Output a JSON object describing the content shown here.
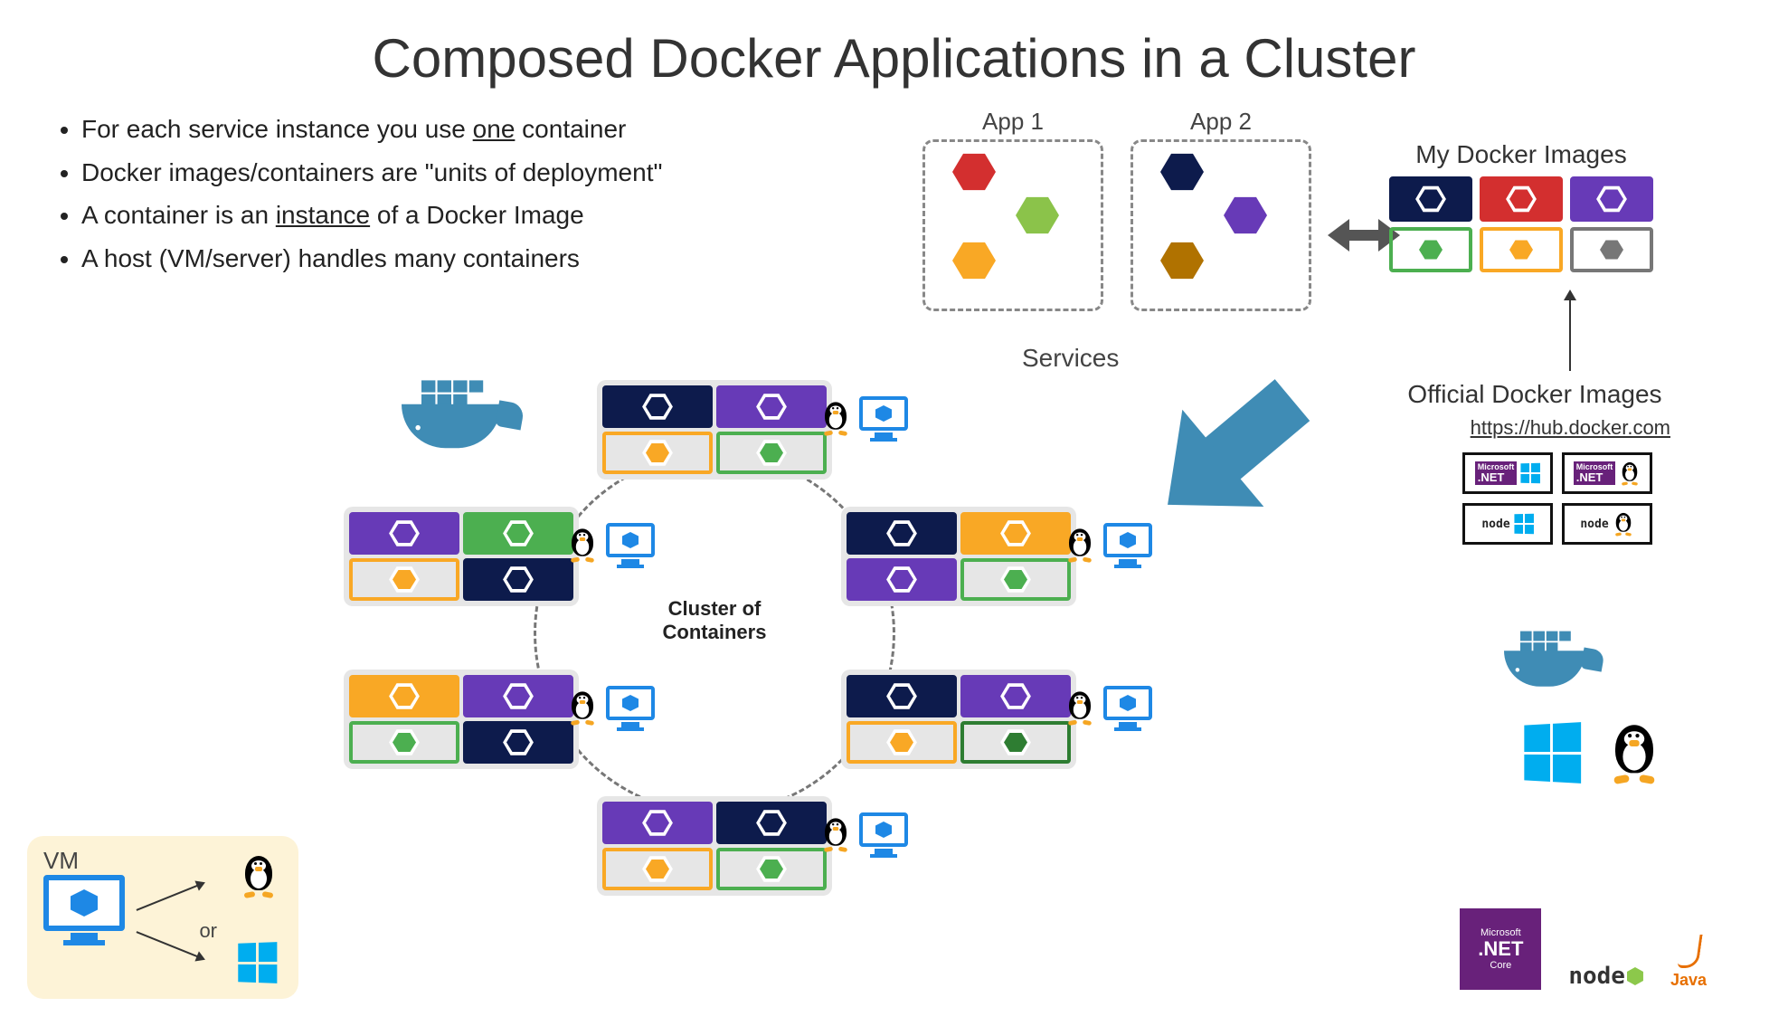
{
  "title": "Composed Docker Applications in a Cluster",
  "bullets": [
    {
      "pre": "For each service instance you use ",
      "u": "one",
      "post": " container"
    },
    {
      "pre": "Docker images/containers are \"units of deployment\"",
      "u": "",
      "post": ""
    },
    {
      "pre": "A container is an ",
      "u": "instance",
      "post": " of a Docker Image"
    },
    {
      "pre": "A host (VM/server) handles many containers",
      "u": "",
      "post": ""
    }
  ],
  "apps": {
    "app1": "App 1",
    "app2": "App 2",
    "services": "Services",
    "app1_colors": [
      "#d32f2f",
      "#8bc34a",
      "#f9a825"
    ],
    "app2_colors": [
      "#0d1b4c",
      "#673ab7",
      "#b07200"
    ]
  },
  "mydocker": {
    "label": "My Docker Images",
    "row1": [
      "#0d1b4c",
      "#d32f2f",
      "#673ab7"
    ],
    "row2": [
      "#4caf50",
      "#f9a825",
      "#777777"
    ]
  },
  "official": {
    "label": "Official Docker Images",
    "link": "https://hub.docker.com",
    "items": [
      {
        "left": ".NET",
        "right": "win"
      },
      {
        "left": ".NET",
        "right": "tux"
      },
      {
        "left": "node",
        "right": "win"
      },
      {
        "left": "node",
        "right": "tux"
      }
    ]
  },
  "cluster": {
    "label_l1": "Cluster of",
    "label_l2": "Containers",
    "nodes": [
      {
        "c": [
          "#0d1b4c",
          "#673ab7",
          "#f9a825",
          "#4caf50"
        ]
      },
      {
        "c": [
          "#673ab7",
          "#4caf50",
          "#f9a825",
          "#0d1b4c"
        ]
      },
      {
        "c": [
          "#0d1b4c",
          "#f9a825",
          "#673ab7",
          "#4caf50"
        ]
      },
      {
        "c": [
          "#f9a825",
          "#673ab7",
          "#4caf50",
          "#0d1b4c"
        ]
      },
      {
        "c": [
          "#0d1b4c",
          "#673ab7",
          "#f9a825",
          "#2e7d32"
        ]
      },
      {
        "c": [
          "#673ab7",
          "#0d1b4c",
          "#f9a825",
          "#4caf50"
        ]
      }
    ]
  },
  "vm": {
    "title": "VM",
    "or": "or"
  },
  "tech": {
    "netcore_top": "Microsoft",
    "netcore_mid": ".NET",
    "netcore_bot": "Core",
    "node": "node",
    "java": "Java"
  }
}
